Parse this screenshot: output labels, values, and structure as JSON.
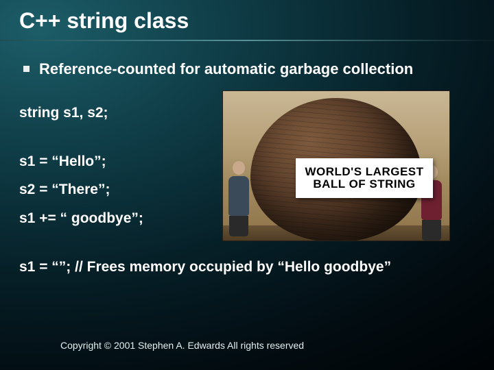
{
  "title": "C++ string class",
  "bullet": "Reference-counted for automatic garbage collection",
  "code": {
    "decl": "string s1, s2;",
    "a1": "s1 = “Hello”;",
    "a2": "s2 = “There”;",
    "a3": "s1 += “ goodbye”;",
    "a4_code": "s1 = “”; ",
    "a4_comment": "// Frees memory occupied by “Hello goodbye”"
  },
  "sign": {
    "line1": "WORLD'S LARGEST",
    "line2": "BALL OF STRING"
  },
  "copyright": "Copyright © 2001 Stephen A. Edwards  All rights reserved"
}
